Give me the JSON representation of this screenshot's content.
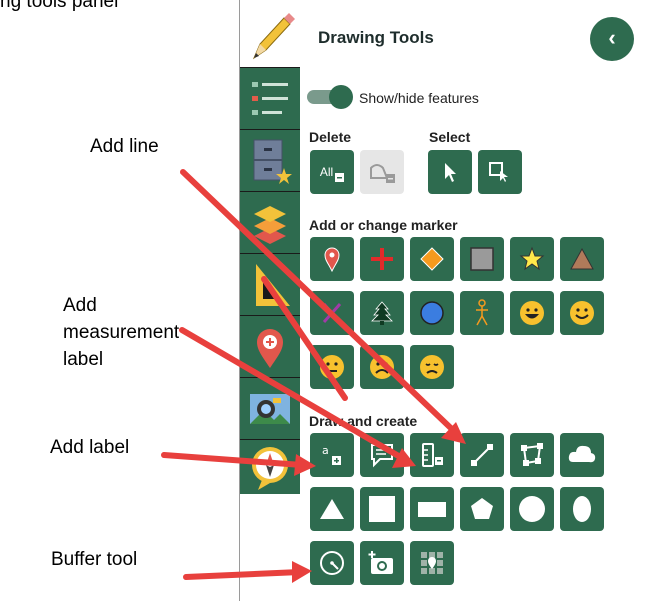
{
  "top_crop_text": "ng tools panel",
  "annotations": {
    "add_line": "Add line",
    "add_measurement_label": [
      "Add",
      "measurement",
      "label"
    ],
    "add_label": "Add label",
    "buffer_tool": "Buffer tool"
  },
  "panel": {
    "title": "Drawing Tools",
    "collapse_glyph": "‹",
    "toggle_label": "Show/hide features",
    "toggle_on": true,
    "sections": {
      "delete": "Delete",
      "select": "Select",
      "marker": "Add or change marker",
      "draw": "Draw and create"
    },
    "delete_all_label": "All"
  },
  "toolbar_icons": [
    "pencil-icon",
    "legend-list-icon",
    "cabinet-star-icon",
    "layers-icon",
    "ruler-triangle-icon",
    "map-pin-plus-icon",
    "photo-icon",
    "compass-icon"
  ],
  "colors": {
    "accent": "#2e6b4f",
    "toolbar_bg": "#1a1a1a",
    "arrow": "#e8403d"
  }
}
